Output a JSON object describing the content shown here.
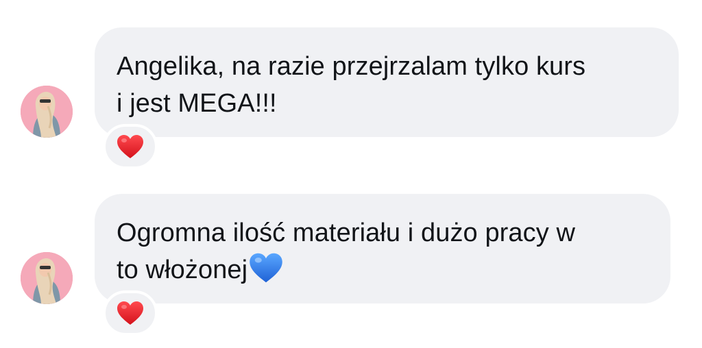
{
  "messages": [
    {
      "text": "Angelika, na razie przejrzalam tylko kurs\ni jest MEGA!!!",
      "reaction": "red-heart-icon"
    },
    {
      "text": "Ogromna ilość materiału i dużo pracy w\nto włożonej",
      "inline_emoji": "blue-heart-icon",
      "reaction": "red-heart-icon"
    }
  ],
  "colors": {
    "bubble": "#f0f1f4",
    "text": "#111418",
    "heart_red": "#e8202a",
    "heart_blue": "#2f7fe6",
    "avatar_bg": "#f4a6b4"
  }
}
